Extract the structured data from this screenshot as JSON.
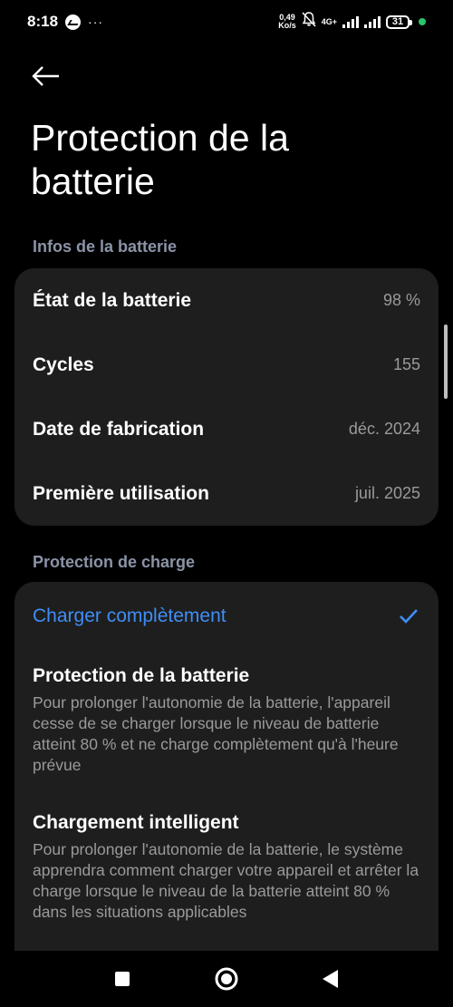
{
  "status_bar": {
    "time": "8:18",
    "dots": "···",
    "speed_value": "0,49",
    "speed_unit": "Ko/s",
    "network": "4G+",
    "battery": "31"
  },
  "header": {
    "title": "Protection de la batterie"
  },
  "battery_info": {
    "section_label": "Infos de la batterie",
    "rows": [
      {
        "label": "État de la batterie",
        "value": "98 %"
      },
      {
        "label": "Cycles",
        "value": "155"
      },
      {
        "label": "Date de fabrication",
        "value": "déc. 2024"
      },
      {
        "label": "Première utilisation",
        "value": "juil. 2025"
      }
    ]
  },
  "charge_protection": {
    "section_label": "Protection de charge",
    "selected_option": "Charger complètement",
    "options": [
      {
        "title": "Protection de la batterie",
        "description": "Pour prolonger l'autonomie de la batterie, l'appareil cesse de se charger lorsque le niveau de batterie atteint 80 % et ne charge complètement qu'à l'heure prévue"
      },
      {
        "title": "Chargement intelligent",
        "description": "Pour prolonger l'autonomie de la batterie, le système apprendra comment charger votre appareil et arrêter la charge lorsque le niveau de la batterie atteint 80 % dans les situations applicables"
      }
    ]
  },
  "colors": {
    "background": "#000000",
    "card": "#1e1e1e",
    "accent": "#3f8ef7",
    "secondary_text": "#9a9a9a",
    "section_label": "#8b93a7"
  },
  "icons": [
    "messenger-icon",
    "bell-muted-icon",
    "signal-icon",
    "battery-icon",
    "back-arrow-icon",
    "checkmark-icon",
    "square-nav-icon",
    "home-nav-icon",
    "back-nav-icon"
  ]
}
